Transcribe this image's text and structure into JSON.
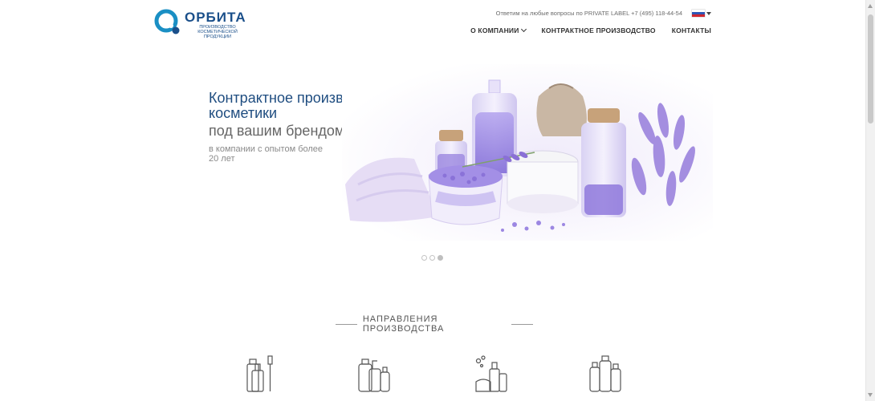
{
  "brand": {
    "name": "ОРБИТА",
    "tagline": "производство косметической продукции",
    "color": "#1a4f8a"
  },
  "topline": {
    "contact_text": "Ответим на любые вопросы по PRIVATE LABEL +7 (495) 118-44-54",
    "language_flag": "flag-russia-icon"
  },
  "nav": {
    "items": [
      {
        "label": "О КОМПАНИИ",
        "has_dropdown": true
      },
      {
        "label": "КОНТРАКТНОЕ ПРОИЗВОДСТВО",
        "has_dropdown": false
      },
      {
        "label": "КОНТАКТЫ",
        "has_dropdown": false
      }
    ]
  },
  "hero": {
    "title": "Контрактное производство косметики",
    "subtitle": "под вашим брендом",
    "note": "в компании с опытом более 20 лет",
    "image": "lavender-cosmetics-photo",
    "slides": 3,
    "active_slide": 3
  },
  "section": {
    "title": "НАПРАВЛЕНИЯ ПРОИЗВОДСТВА",
    "categories": [
      {
        "icon": "toothpaste-toothbrush-icon"
      },
      {
        "icon": "shampoo-bottles-icon"
      },
      {
        "icon": "bath-products-icon"
      },
      {
        "icon": "cosmetic-bottles-icon"
      }
    ]
  },
  "colors": {
    "title_blue": "#1f4d80",
    "lavender": "#9b87e0"
  }
}
